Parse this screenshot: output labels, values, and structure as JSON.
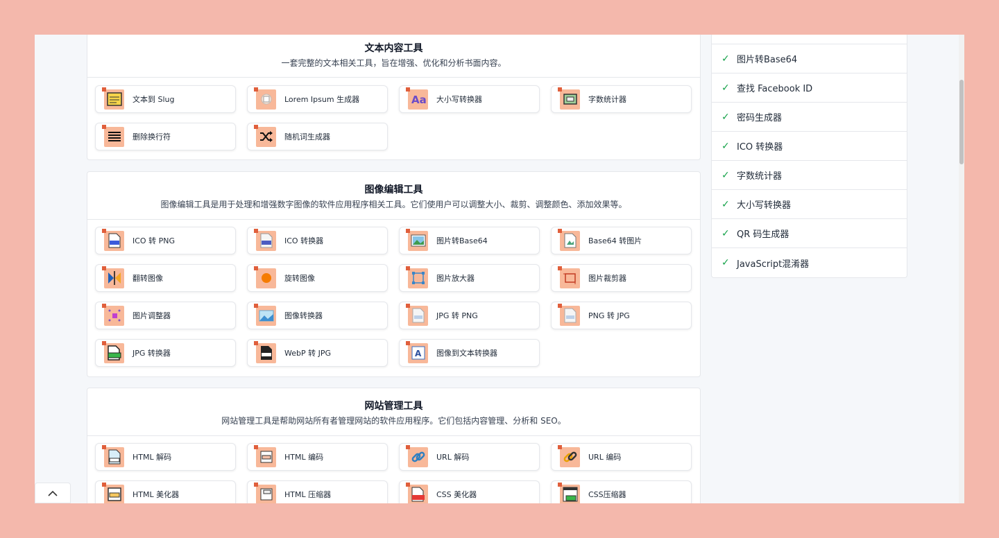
{
  "sections": [
    {
      "title": "文本内容工具",
      "desc": "一套完整的文本相关工具，旨在增强、优化和分析书面内容。",
      "tools": [
        {
          "label": "文本到 Slug",
          "icon": "document-icon"
        },
        {
          "label": "Lorem Ipsum 生成器",
          "icon": "text-generator-icon"
        },
        {
          "label": "大小写转换器",
          "icon": "letter-case-icon"
        },
        {
          "label": "字数统计器",
          "icon": "counter-icon"
        },
        {
          "label": "删除换行符",
          "icon": "lines-icon"
        },
        {
          "label": "随机词生成器",
          "icon": "shuffle-icon"
        }
      ]
    },
    {
      "title": "图像编辑工具",
      "desc": "图像编辑工具是用于处理和增强数字图像的软件应用程序相关工具。它们使用户可以调整大小、裁剪、调整颜色、添加效果等。",
      "tools": [
        {
          "label": "ICO 转 PNG",
          "icon": "ico-file-icon"
        },
        {
          "label": "ICO 转换器",
          "icon": "ico-file-icon"
        },
        {
          "label": "图片转Base64",
          "icon": "image-icon"
        },
        {
          "label": "Base64 转图片",
          "icon": "image-file-icon"
        },
        {
          "label": "翻转图像",
          "icon": "flip-icon"
        },
        {
          "label": "旋转图像",
          "icon": "rotate-icon"
        },
        {
          "label": "图片放大器",
          "icon": "enlarge-icon"
        },
        {
          "label": "图片裁剪器",
          "icon": "crop-icon"
        },
        {
          "label": "图片调整器",
          "icon": "resize-icon"
        },
        {
          "label": "图像转换器",
          "icon": "image-convert-icon"
        },
        {
          "label": "JPG 转 PNG",
          "icon": "png-file-icon"
        },
        {
          "label": "PNG 转 JPG",
          "icon": "jpg-file-icon"
        },
        {
          "label": "JPG 转换器",
          "icon": "jpg-file-icon"
        },
        {
          "label": "WebP 转 JPG",
          "icon": "webp-file-icon"
        },
        {
          "label": "图像到文本转换器",
          "icon": "ocr-icon"
        }
      ]
    },
    {
      "title": "网站管理工具",
      "desc": "网站管理工具是帮助网站所有者管理网站的软件应用程序。它们包括内容管理、分析和 SEO。",
      "tools": [
        {
          "label": "HTML 解码",
          "icon": "html-file-icon"
        },
        {
          "label": "HTML 编码",
          "icon": "html-file-icon"
        },
        {
          "label": "URL 解码",
          "icon": "link-icon"
        },
        {
          "label": "URL 编码",
          "icon": "link-icon"
        },
        {
          "label": "HTML 美化器",
          "icon": "html-file-icon"
        },
        {
          "label": "HTML 压缩器",
          "icon": "html-file-icon"
        },
        {
          "label": "CSS 美化器",
          "icon": "css-file-icon"
        },
        {
          "label": "CSS压缩器",
          "icon": "css-file-icon"
        }
      ]
    }
  ],
  "sidebar": {
    "items": [
      {
        "label": "图片转Base64"
      },
      {
        "label": "查找 Facebook ID"
      },
      {
        "label": "密码生成器"
      },
      {
        "label": "ICO 转换器"
      },
      {
        "label": "字数统计器"
      },
      {
        "label": "大小写转换器"
      },
      {
        "label": "QR 码生成器"
      },
      {
        "label": "JavaScript混淆器"
      }
    ],
    "check_color": "#16a34a"
  },
  "colors": {
    "icon_bg": "#f8b899",
    "icon_corner": "#e05f3c",
    "frame": "#f4b8ac"
  }
}
